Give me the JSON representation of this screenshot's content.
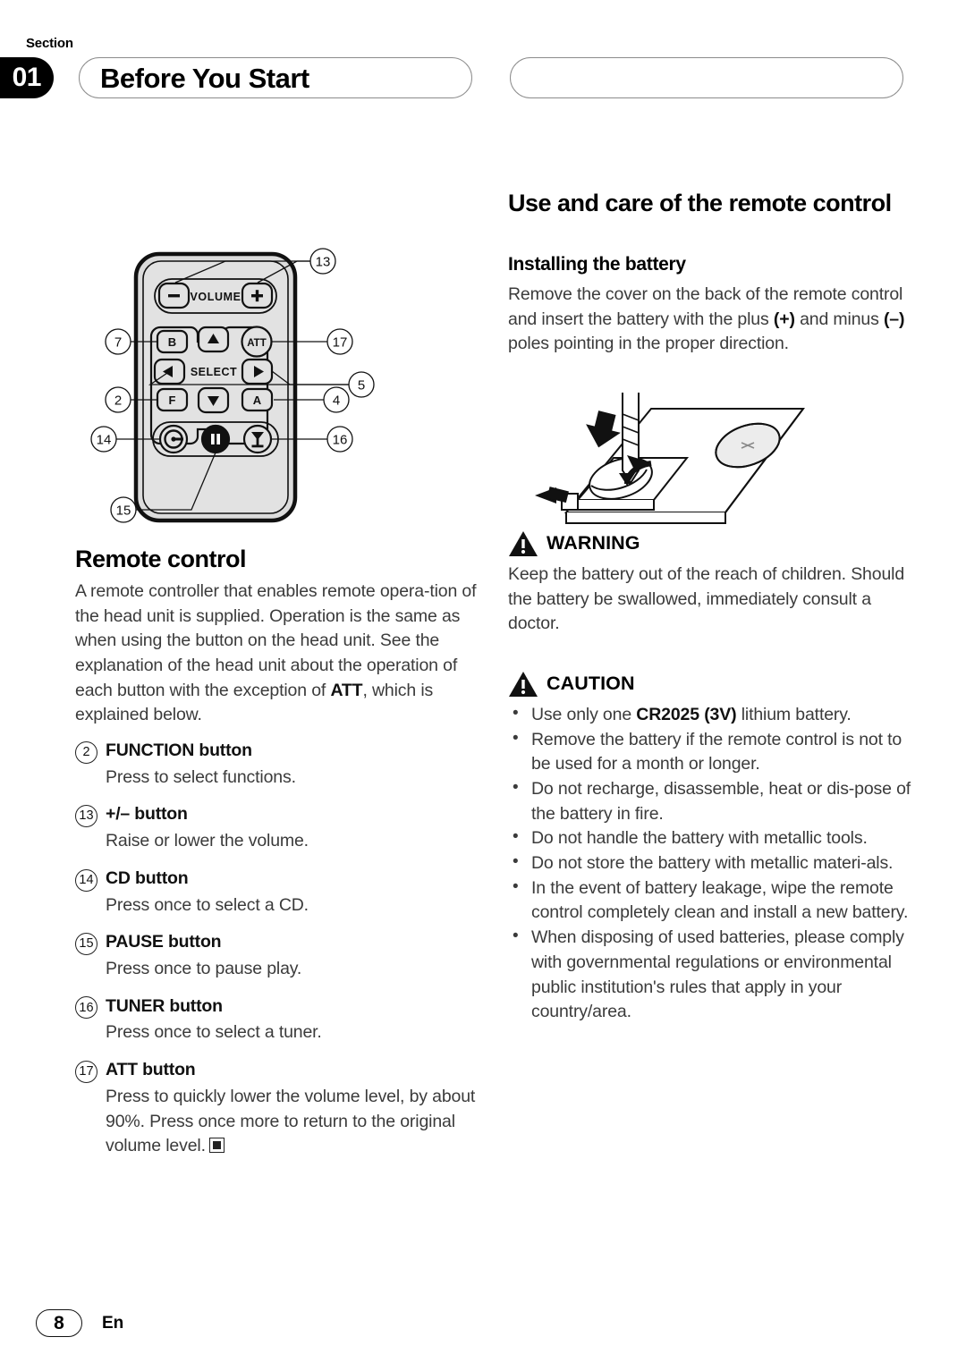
{
  "header": {
    "section_word": "Section",
    "section_number": "01",
    "title": "Before You Start",
    "right_box_text": ""
  },
  "figure": {
    "name": "remote-control-diagram",
    "labels": {
      "volume": "VOLUME",
      "select": "SELECT",
      "att": "ATT",
      "btn_b": "B",
      "btn_f": "F",
      "btn_a": "A",
      "minus": "–",
      "plus": "+"
    },
    "callouts": [
      {
        "id": "13",
        "side": "right",
        "target": "volume-buttons"
      },
      {
        "id": "17",
        "side": "right",
        "target": "att-button"
      },
      {
        "id": "5",
        "side": "right",
        "target": "arrow-buttons"
      },
      {
        "id": "4",
        "side": "right",
        "target": "a-button"
      },
      {
        "id": "16",
        "side": "right",
        "target": "tuner-button"
      },
      {
        "id": "7",
        "side": "left",
        "target": "b-button"
      },
      {
        "id": "2",
        "side": "left",
        "target": "f-button"
      },
      {
        "id": "14",
        "side": "left",
        "target": "cd-button"
      },
      {
        "id": "15",
        "side": "left",
        "target": "pause-button"
      }
    ]
  },
  "left_column": {
    "heading": "Remote control",
    "intro_parts": [
      "A remote controller that enables remote opera-tion of the head unit is supplied. Operation is the same as when using the button on the head unit. See the explanation of the head unit about the operation of each button with the exception of ",
      "ATT",
      ", which is explained below."
    ],
    "buttons": [
      {
        "num": "2",
        "label": "FUNCTION button",
        "desc": "Press to select functions."
      },
      {
        "num": "13",
        "label": "+/– button",
        "desc": "Raise or lower the volume."
      },
      {
        "num": "14",
        "label": "CD button",
        "desc": "Press once to select a CD."
      },
      {
        "num": "15",
        "label": "PAUSE button",
        "desc": "Press once to pause play."
      },
      {
        "num": "16",
        "label": "TUNER button",
        "desc": "Press once to select a tuner."
      },
      {
        "num": "17",
        "label": "ATT button",
        "desc": "Press to quickly lower the volume level, by about 90%. Press once more to return to the original volume level.",
        "end_mark": true
      }
    ]
  },
  "right_column": {
    "heading": "Use and care of the remote control",
    "subheading": "Installing the battery",
    "intro_parts": [
      "Remove the cover on the back of the remote control and insert the battery with the plus ",
      "(+)",
      " and minus ",
      "(–)",
      " poles pointing in the proper direction."
    ],
    "battery_figure_name": "battery-installation-diagram",
    "warning": {
      "title": "WARNING",
      "body": "Keep the battery out of the reach of children. Should the battery be swallowed, immediately consult a doctor."
    },
    "caution": {
      "title": "CAUTION",
      "items": [
        {
          "pre": "Use only one ",
          "bold": "CR2025 (3V)",
          "post": " lithium battery."
        },
        {
          "pre": "Remove the battery if the remote control is not to be used for a month or longer.",
          "bold": "",
          "post": ""
        },
        {
          "pre": "Do not recharge, disassemble, heat or dis-pose of the battery in fire.",
          "bold": "",
          "post": ""
        },
        {
          "pre": "Do not handle the battery with metallic tools.",
          "bold": "",
          "post": ""
        },
        {
          "pre": "Do not store the battery with metallic materi-als.",
          "bold": "",
          "post": ""
        },
        {
          "pre": "In the event of battery leakage, wipe the remote control completely clean and install a new battery.",
          "bold": "",
          "post": ""
        },
        {
          "pre": "When disposing of used batteries, please comply with governmental regulations or environmental public institution's rules that apply in your country/area.",
          "bold": "",
          "post": ""
        }
      ]
    }
  },
  "footer": {
    "page_number": "8",
    "language": "En"
  }
}
